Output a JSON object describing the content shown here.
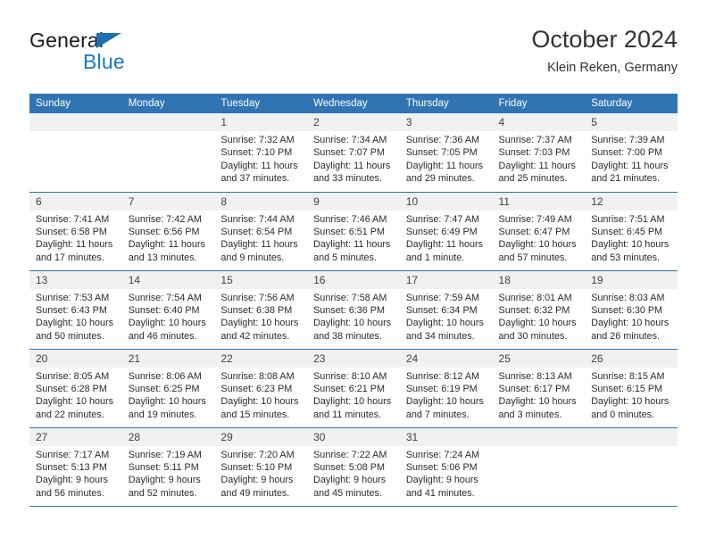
{
  "brand": {
    "name_top": "General",
    "name_bottom": "Blue"
  },
  "header": {
    "title": "October 2024",
    "subtitle": "Klein Reken, Germany"
  },
  "colors": {
    "header_blue": "#3174b4",
    "brand_blue": "#1a7ac4",
    "daynum_bg": "#f1f1f1",
    "text": "#2b2b2b"
  },
  "calendar": {
    "weekday_headers": [
      "Sunday",
      "Monday",
      "Tuesday",
      "Wednesday",
      "Thursday",
      "Friday",
      "Saturday"
    ],
    "weeks": [
      [
        {
          "day": "",
          "sunrise": "",
          "sunset": "",
          "daylight": "",
          "empty": true
        },
        {
          "day": "",
          "sunrise": "",
          "sunset": "",
          "daylight": "",
          "empty": true
        },
        {
          "day": "1",
          "sunrise": "Sunrise: 7:32 AM",
          "sunset": "Sunset: 7:10 PM",
          "daylight": "Daylight: 11 hours and 37 minutes."
        },
        {
          "day": "2",
          "sunrise": "Sunrise: 7:34 AM",
          "sunset": "Sunset: 7:07 PM",
          "daylight": "Daylight: 11 hours and 33 minutes."
        },
        {
          "day": "3",
          "sunrise": "Sunrise: 7:36 AM",
          "sunset": "Sunset: 7:05 PM",
          "daylight": "Daylight: 11 hours and 29 minutes."
        },
        {
          "day": "4",
          "sunrise": "Sunrise: 7:37 AM",
          "sunset": "Sunset: 7:03 PM",
          "daylight": "Daylight: 11 hours and 25 minutes."
        },
        {
          "day": "5",
          "sunrise": "Sunrise: 7:39 AM",
          "sunset": "Sunset: 7:00 PM",
          "daylight": "Daylight: 11 hours and 21 minutes."
        }
      ],
      [
        {
          "day": "6",
          "sunrise": "Sunrise: 7:41 AM",
          "sunset": "Sunset: 6:58 PM",
          "daylight": "Daylight: 11 hours and 17 minutes."
        },
        {
          "day": "7",
          "sunrise": "Sunrise: 7:42 AM",
          "sunset": "Sunset: 6:56 PM",
          "daylight": "Daylight: 11 hours and 13 minutes."
        },
        {
          "day": "8",
          "sunrise": "Sunrise: 7:44 AM",
          "sunset": "Sunset: 6:54 PM",
          "daylight": "Daylight: 11 hours and 9 minutes."
        },
        {
          "day": "9",
          "sunrise": "Sunrise: 7:46 AM",
          "sunset": "Sunset: 6:51 PM",
          "daylight": "Daylight: 11 hours and 5 minutes."
        },
        {
          "day": "10",
          "sunrise": "Sunrise: 7:47 AM",
          "sunset": "Sunset: 6:49 PM",
          "daylight": "Daylight: 11 hours and 1 minute."
        },
        {
          "day": "11",
          "sunrise": "Sunrise: 7:49 AM",
          "sunset": "Sunset: 6:47 PM",
          "daylight": "Daylight: 10 hours and 57 minutes."
        },
        {
          "day": "12",
          "sunrise": "Sunrise: 7:51 AM",
          "sunset": "Sunset: 6:45 PM",
          "daylight": "Daylight: 10 hours and 53 minutes."
        }
      ],
      [
        {
          "day": "13",
          "sunrise": "Sunrise: 7:53 AM",
          "sunset": "Sunset: 6:43 PM",
          "daylight": "Daylight: 10 hours and 50 minutes."
        },
        {
          "day": "14",
          "sunrise": "Sunrise: 7:54 AM",
          "sunset": "Sunset: 6:40 PM",
          "daylight": "Daylight: 10 hours and 46 minutes."
        },
        {
          "day": "15",
          "sunrise": "Sunrise: 7:56 AM",
          "sunset": "Sunset: 6:38 PM",
          "daylight": "Daylight: 10 hours and 42 minutes."
        },
        {
          "day": "16",
          "sunrise": "Sunrise: 7:58 AM",
          "sunset": "Sunset: 6:36 PM",
          "daylight": "Daylight: 10 hours and 38 minutes."
        },
        {
          "day": "17",
          "sunrise": "Sunrise: 7:59 AM",
          "sunset": "Sunset: 6:34 PM",
          "daylight": "Daylight: 10 hours and 34 minutes."
        },
        {
          "day": "18",
          "sunrise": "Sunrise: 8:01 AM",
          "sunset": "Sunset: 6:32 PM",
          "daylight": "Daylight: 10 hours and 30 minutes."
        },
        {
          "day": "19",
          "sunrise": "Sunrise: 8:03 AM",
          "sunset": "Sunset: 6:30 PM",
          "daylight": "Daylight: 10 hours and 26 minutes."
        }
      ],
      [
        {
          "day": "20",
          "sunrise": "Sunrise: 8:05 AM",
          "sunset": "Sunset: 6:28 PM",
          "daylight": "Daylight: 10 hours and 22 minutes."
        },
        {
          "day": "21",
          "sunrise": "Sunrise: 8:06 AM",
          "sunset": "Sunset: 6:25 PM",
          "daylight": "Daylight: 10 hours and 19 minutes."
        },
        {
          "day": "22",
          "sunrise": "Sunrise: 8:08 AM",
          "sunset": "Sunset: 6:23 PM",
          "daylight": "Daylight: 10 hours and 15 minutes."
        },
        {
          "day": "23",
          "sunrise": "Sunrise: 8:10 AM",
          "sunset": "Sunset: 6:21 PM",
          "daylight": "Daylight: 10 hours and 11 minutes."
        },
        {
          "day": "24",
          "sunrise": "Sunrise: 8:12 AM",
          "sunset": "Sunset: 6:19 PM",
          "daylight": "Daylight: 10 hours and 7 minutes."
        },
        {
          "day": "25",
          "sunrise": "Sunrise: 8:13 AM",
          "sunset": "Sunset: 6:17 PM",
          "daylight": "Daylight: 10 hours and 3 minutes."
        },
        {
          "day": "26",
          "sunrise": "Sunrise: 8:15 AM",
          "sunset": "Sunset: 6:15 PM",
          "daylight": "Daylight: 10 hours and 0 minutes."
        }
      ],
      [
        {
          "day": "27",
          "sunrise": "Sunrise: 7:17 AM",
          "sunset": "Sunset: 5:13 PM",
          "daylight": "Daylight: 9 hours and 56 minutes."
        },
        {
          "day": "28",
          "sunrise": "Sunrise: 7:19 AM",
          "sunset": "Sunset: 5:11 PM",
          "daylight": "Daylight: 9 hours and 52 minutes."
        },
        {
          "day": "29",
          "sunrise": "Sunrise: 7:20 AM",
          "sunset": "Sunset: 5:10 PM",
          "daylight": "Daylight: 9 hours and 49 minutes."
        },
        {
          "day": "30",
          "sunrise": "Sunrise: 7:22 AM",
          "sunset": "Sunset: 5:08 PM",
          "daylight": "Daylight: 9 hours and 45 minutes."
        },
        {
          "day": "31",
          "sunrise": "Sunrise: 7:24 AM",
          "sunset": "Sunset: 5:06 PM",
          "daylight": "Daylight: 9 hours and 41 minutes."
        },
        {
          "day": "",
          "sunrise": "",
          "sunset": "",
          "daylight": "",
          "empty": true
        },
        {
          "day": "",
          "sunrise": "",
          "sunset": "",
          "daylight": "",
          "empty": true
        }
      ]
    ]
  }
}
